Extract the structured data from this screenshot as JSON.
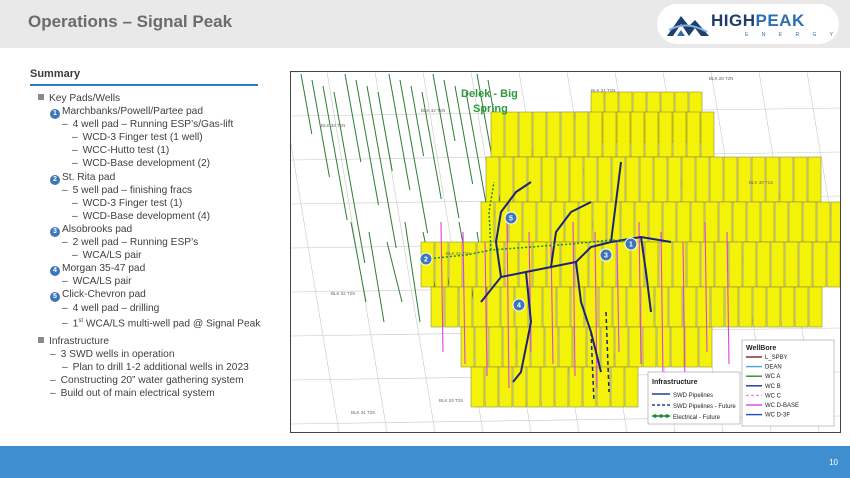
{
  "header": {
    "title": "Operations – Signal Peak",
    "logo_main_1": "HIGH",
    "logo_main_2": "PEAK",
    "logo_sub": "E N E R G Y"
  },
  "summary": {
    "title": "Summary",
    "key_pads_label": "Key Pads/Wells",
    "pads": [
      {
        "num": "1",
        "name": "Marchbanks/Powell/Partee pad"
      },
      {
        "num": "2",
        "name": "St. Rita pad"
      },
      {
        "num": "3",
        "name": "Alsobrooks pad"
      },
      {
        "num": "4",
        "name": "Morgan 35-47 pad"
      },
      {
        "num": "5",
        "name": "Click-Chevron pad"
      }
    ],
    "lines": {
      "p1a": "4 well pad – Running ESP’s/Gas-lift",
      "p1b": "WCD-3 Finger test (1 well)",
      "p1c": "WCC-Hutto test (1)",
      "p1d": "WCD-Base development (2)",
      "p2a": "5 well pad – finishing fracs",
      "p2b": "WCD-3 Finger test (1)",
      "p2c": "WCD-Base development (4)",
      "p3a": "2 well pad – Running ESP’s",
      "p3b": "WCA/LS pair",
      "p4a": "WCA/LS pair",
      "p5a": "4 well pad – drilling",
      "p5b_pre": "1",
      "p5b_sup": "st",
      "p5b_post": " WCA/LS multi-well pad @ Signal Peak"
    },
    "infra_label": "Infrastructure",
    "infra": {
      "i1": "3 SWD wells in operation",
      "i1a": "Plan to drill 1-2 additional wells in 2023",
      "i2": "Constructing 20” water gathering system",
      "i3": "Build out of main electrical system"
    }
  },
  "map": {
    "field_label_1": "Delek - Big",
    "field_label_2": "Spring",
    "blocks": [
      "BLK 28 T2N",
      "BLK 31 T1N",
      "BLK 32 T1N",
      "BLK 30 T1S",
      "BLK 33 T1N",
      "BLK 34 T1N",
      "BLK 32 T2S",
      "BLK 33 T2S",
      "BLK 31 T2S"
    ],
    "markers": [
      "1",
      "2",
      "3",
      "4",
      "5"
    ],
    "legend_infra": {
      "title": "Infrastructure",
      "items": [
        "SWD Pipelines",
        "SWD Pipelines - Future",
        "Electrical - Future"
      ],
      "colors": [
        "#1f3fa8",
        "#1f3fa8",
        "#1b8a2e"
      ]
    },
    "legend_wellbore": {
      "title": "WellBore",
      "items": [
        "L_SPBY",
        "DEAN",
        "WC A",
        "WC B",
        "WC C",
        "WC D-BASE",
        "WC D-3F"
      ],
      "colors": [
        "#8b1a1a",
        "#4aa3df",
        "#2e8b3a",
        "#1f2f9a",
        "#c9a0dc",
        "#e040e0",
        "#1f4fa8"
      ]
    },
    "colors": {
      "tract": "#f5f20a",
      "gas_line": "#2e7d32",
      "swd": "#1a237e",
      "electric": "#1b8a2e",
      "well_pink": "#e040e0"
    }
  },
  "footer": {
    "page": "10"
  }
}
